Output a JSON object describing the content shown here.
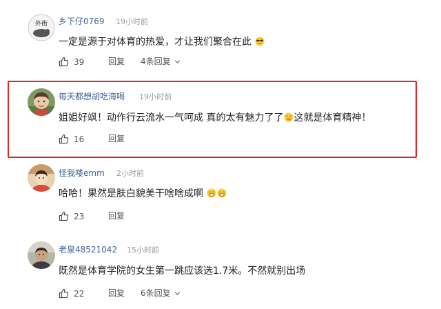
{
  "comments": [
    {
      "username": "乡下仔0769",
      "time": "19小时前",
      "text": "一定是源于对体育的热爱，才让我们聚合在此",
      "emoji": [
        "sunglasses-emoji"
      ],
      "likes": "39",
      "reply_label": "回复",
      "replies_label": "4条回复",
      "avatar": "sports-logo-avatar"
    },
    {
      "username": "每天都想胡吃海喝",
      "time": "19小时前",
      "text": "姐姐好飒！动作行云流水一气呵成 真的太有魅力了了",
      "text_after": "这就是体育精神！",
      "emoji": [
        "hand-over-mouth-emoji"
      ],
      "likes": "16",
      "reply_label": "回复",
      "avatar": "cartoon-avatar"
    },
    {
      "username": "怪我喽emm",
      "time": "2小时前",
      "text": "哈哈！果然是肤白貌美干啥啥成啊",
      "emoji": [
        "grin-emoji",
        "grin-emoji"
      ],
      "likes": "23",
      "reply_label": "回复",
      "avatar": "photo-avatar"
    },
    {
      "username": "老泉48521042",
      "time": "15小时前",
      "text": "既然是体育学院的女生第一跳应该选1.7米。不然就别出场",
      "likes": "22",
      "reply_label": "回复",
      "replies_label": "6条回复",
      "avatar": "photo-avatar"
    }
  ],
  "colors": {
    "username": "#406599",
    "time": "#999999",
    "highlight_border": "#e0262b"
  }
}
